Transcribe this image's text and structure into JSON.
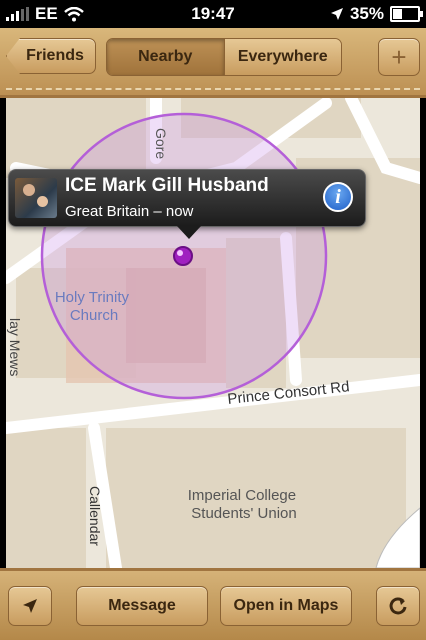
{
  "status_bar": {
    "carrier": "EE",
    "time": "19:47",
    "battery": "35%",
    "battery_level": 0.35
  },
  "top_bar": {
    "back_label": "Friends",
    "segments": [
      "Nearby",
      "Everywhere"
    ],
    "selected_segment": "Nearby",
    "add_label": "+"
  },
  "map": {
    "labels": {
      "gore": "Gore",
      "church": "Holy Trinity Church",
      "mews": "lay Mews",
      "road": "Prince Consort Rd",
      "college": "Imperial College Students' Union",
      "callendar": "Callendar"
    }
  },
  "callout": {
    "name": "ICE Mark Gill Husband",
    "subtitle": "Great Britain – now"
  },
  "bottom_bar": {
    "message_label": "Message",
    "maps_label": "Open in Maps"
  },
  "icons": [
    "location-arrow-icon",
    "refresh-icon",
    "info-icon",
    "wifi-icon",
    "signal-icon",
    "battery-icon"
  ],
  "colors": {
    "leather": "#c89c5f",
    "accuracy_circle": "#b45fd8",
    "pin": "#a020c0"
  }
}
